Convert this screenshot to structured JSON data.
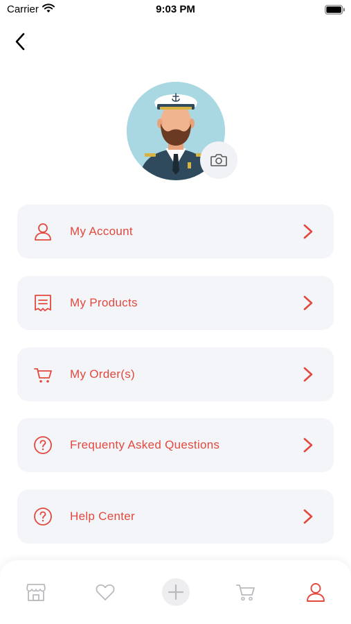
{
  "status_bar": {
    "carrier": "Carrier",
    "time": "9:03 PM"
  },
  "colors": {
    "accent": "#e2483d",
    "card_bg": "#f4f5f8",
    "avatar_bg": "#a9d8e3",
    "tab_inactive": "#b9b9be"
  },
  "menu": {
    "items": [
      {
        "label": "My Account",
        "icon": "user-icon"
      },
      {
        "label": "My Products",
        "icon": "receipt-icon"
      },
      {
        "label": "My Order(s)",
        "icon": "cart-icon"
      },
      {
        "label": "Frequenty Asked Questions",
        "icon": "question-icon"
      },
      {
        "label": "Help Center",
        "icon": "question-icon"
      }
    ]
  },
  "tab_bar": {
    "tabs": [
      {
        "icon": "store-icon",
        "active": false
      },
      {
        "icon": "heart-icon",
        "active": false
      },
      {
        "icon": "plus-icon",
        "active": false
      },
      {
        "icon": "cart-icon",
        "active": false
      },
      {
        "icon": "profile-icon",
        "active": true
      }
    ]
  }
}
